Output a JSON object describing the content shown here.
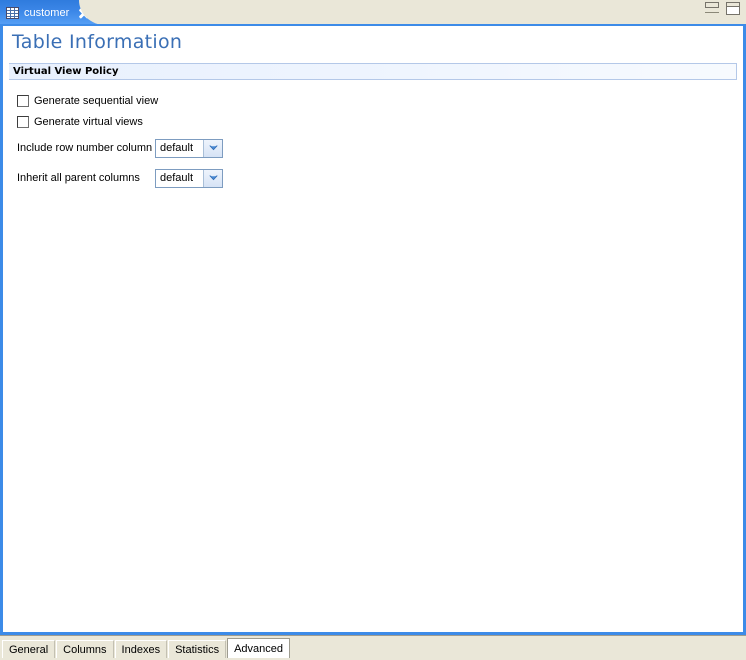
{
  "window": {
    "editor_tab": {
      "label": "customer",
      "icon": "table-icon",
      "close_icon": "close-icon"
    },
    "controls": {
      "minimize": "minimize-button",
      "maximize": "maximize-button"
    }
  },
  "page": {
    "title": "Table Information"
  },
  "section": {
    "title": "Virtual View Policy"
  },
  "form": {
    "checkboxes": [
      {
        "label": "Generate sequential view",
        "checked": false
      },
      {
        "label": "Generate virtual views",
        "checked": false
      }
    ],
    "combos": [
      {
        "label": "Include row number column",
        "value": "default"
      },
      {
        "label": "Inherit all parent columns",
        "value": "default"
      }
    ]
  },
  "bottom_tabs": [
    {
      "label": "General",
      "selected": false
    },
    {
      "label": "Columns",
      "selected": false
    },
    {
      "label": "Indexes",
      "selected": false
    },
    {
      "label": "Statistics",
      "selected": false
    },
    {
      "label": "Advanced",
      "selected": true
    }
  ],
  "colors": {
    "tab_blue": "#3c87e8",
    "frame_border": "#3c8be8",
    "title_text": "#3a6fb5",
    "chrome_beige": "#eae7d8",
    "section_bg": "#e8f0fd"
  }
}
